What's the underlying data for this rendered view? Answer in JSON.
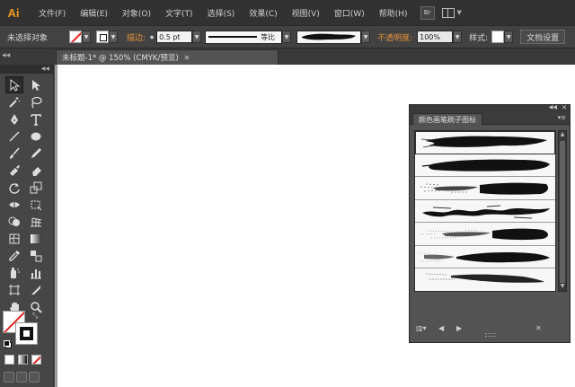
{
  "app": {
    "logo": "Ai"
  },
  "menubar": {
    "items": [
      "文件(F)",
      "编辑(E)",
      "对象(O)",
      "文字(T)",
      "选择(S)",
      "效果(C)",
      "视图(V)",
      "窗口(W)",
      "帮助(H)"
    ],
    "bridge_label": "Br"
  },
  "controlbar": {
    "selection_label": "未选择对象",
    "stroke_label": "描边:",
    "stroke_weight": "0.5 pt",
    "stroke_profile": "等比",
    "opacity_label": "不透明度:",
    "opacity_value": "100%",
    "style_label": "样式:",
    "doc_setup_label": "文档设置"
  },
  "tabbar": {
    "doc_title": "未标题-1* @ 150% (CMYK/预览)",
    "close": "✕"
  },
  "brush_panel": {
    "tab_label": "颜色画笔刷子图标",
    "brush_count": 7
  },
  "icons": {
    "swap": "swap-icon",
    "default_colors": "default-colors-icon"
  },
  "colors": {
    "accent_orange": "#e8923a",
    "none_red": "#e02020",
    "app_bg": "#323232",
    "panel_bg": "#535353",
    "artboard": "#ffffff"
  }
}
